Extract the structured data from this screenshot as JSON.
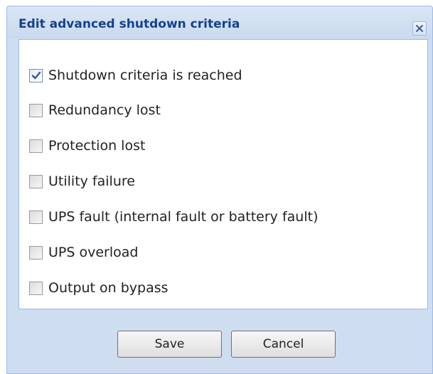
{
  "dialog": {
    "title": "Edit advanced shutdown criteria",
    "close_icon": "close-icon"
  },
  "options": [
    {
      "label": "Shutdown criteria is reached",
      "checked": true
    },
    {
      "label": "Redundancy lost",
      "checked": false
    },
    {
      "label": "Protection lost",
      "checked": false
    },
    {
      "label": "Utility failure",
      "checked": false
    },
    {
      "label": "UPS fault (internal fault or battery fault)",
      "checked": false
    },
    {
      "label": "UPS overload",
      "checked": false
    },
    {
      "label": "Output on bypass",
      "checked": false
    }
  ],
  "footer": {
    "save_label": "Save",
    "cancel_label": "Cancel"
  },
  "colors": {
    "title_text": "#15428b",
    "border": "#99bbe8",
    "frame_background": "#cfddf0",
    "content_background": "#ffffff"
  }
}
